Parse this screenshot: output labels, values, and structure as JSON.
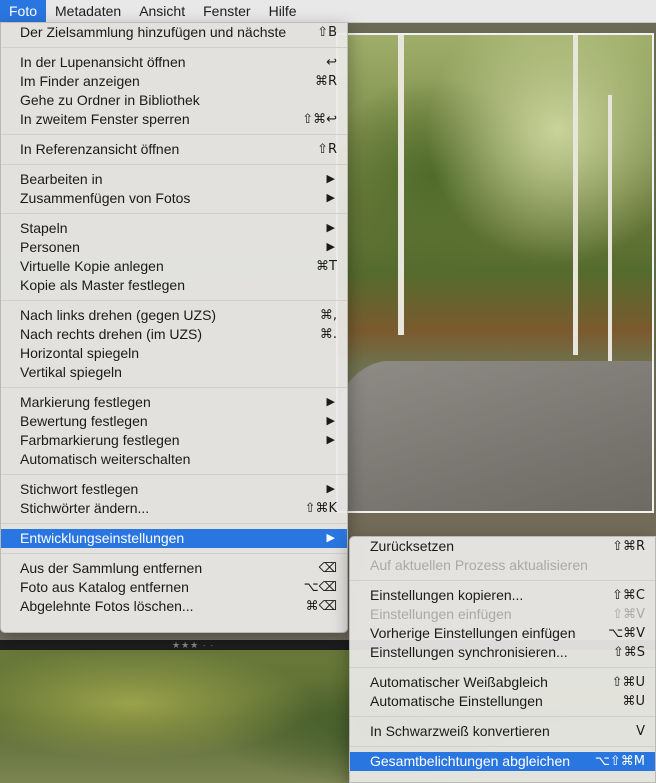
{
  "menubar": [
    {
      "label": "Foto",
      "active": true
    },
    {
      "label": "Metadaten"
    },
    {
      "label": "Ansicht"
    },
    {
      "label": "Fenster"
    },
    {
      "label": "Hilfe"
    }
  ],
  "foto_menu": {
    "groups": [
      [
        {
          "label": "Der Zielsammlung hinzufügen und nächste",
          "shortcut": "⇧B"
        }
      ],
      [
        {
          "label": "In der Lupenansicht öffnen",
          "shortcut": "↩"
        },
        {
          "label": "Im Finder anzeigen",
          "shortcut": "⌘R"
        },
        {
          "label": "Gehe zu Ordner in Bibliothek",
          "shortcut": ""
        },
        {
          "label": "In zweitem Fenster sperren",
          "shortcut": "⇧⌘↩"
        }
      ],
      [
        {
          "label": "In Referenzansicht öffnen",
          "shortcut": "⇧R"
        }
      ],
      [
        {
          "label": "Bearbeiten in",
          "submenu": true
        },
        {
          "label": "Zusammenfügen von Fotos",
          "submenu": true
        }
      ],
      [
        {
          "label": "Stapeln",
          "submenu": true
        },
        {
          "label": "Personen",
          "submenu": true
        },
        {
          "label": "Virtuelle Kopie anlegen",
          "shortcut": "⌘T"
        },
        {
          "label": "Kopie als Master festlegen",
          "shortcut": ""
        }
      ],
      [
        {
          "label": "Nach links drehen (gegen UZS)",
          "shortcut": "⌘,"
        },
        {
          "label": "Nach rechts drehen (im UZS)",
          "shortcut": "⌘."
        },
        {
          "label": "Horizontal spiegeln",
          "shortcut": ""
        },
        {
          "label": "Vertikal spiegeln",
          "shortcut": ""
        }
      ],
      [
        {
          "label": "Markierung festlegen",
          "submenu": true
        },
        {
          "label": "Bewertung festlegen",
          "submenu": true
        },
        {
          "label": "Farbmarkierung festlegen",
          "submenu": true
        },
        {
          "label": "Automatisch weiterschalten",
          "shortcut": ""
        }
      ],
      [
        {
          "label": "Stichwort festlegen",
          "submenu": true
        },
        {
          "label": "Stichwörter ändern...",
          "shortcut": "⇧⌘K"
        }
      ],
      [
        {
          "label": "Entwicklungseinstellungen",
          "submenu": true,
          "highlighted": true
        }
      ],
      [
        {
          "label": "Aus der Sammlung entfernen",
          "shortcut": "⌫"
        },
        {
          "label": "Foto aus Katalog entfernen",
          "shortcut": "⌥⌫"
        },
        {
          "label": "Abgelehnte Fotos löschen...",
          "shortcut": "⌘⌫"
        }
      ]
    ]
  },
  "develop_submenu": {
    "groups": [
      [
        {
          "label": "Zurücksetzen",
          "shortcut": "⇧⌘R"
        },
        {
          "label": "Auf aktuellen Prozess aktualisieren",
          "shortcut": "",
          "disabled": true
        }
      ],
      [
        {
          "label": "Einstellungen kopieren...",
          "shortcut": "⇧⌘C"
        },
        {
          "label": "Einstellungen einfügen",
          "shortcut": "⇧⌘V",
          "disabled": true
        },
        {
          "label": "Vorherige Einstellungen einfügen",
          "shortcut": "⌥⌘V"
        },
        {
          "label": "Einstellungen synchronisieren...",
          "shortcut": "⇧⌘S"
        }
      ],
      [
        {
          "label": "Automatischer Weißabgleich",
          "shortcut": "⇧⌘U"
        },
        {
          "label": "Automatische Einstellungen",
          "shortcut": "⌘U"
        }
      ],
      [
        {
          "label": "In Schwarzweiß konvertieren",
          "shortcut": "V"
        }
      ],
      [
        {
          "label": "Gesamtbelichtungen abgleichen",
          "shortcut": "⌥⇧⌘M",
          "highlighted": true
        }
      ]
    ]
  },
  "filmstrip": {
    "stars": "★★★ · ·"
  },
  "colors": {
    "highlight": "#2a76e0",
    "disabled": "#a9a9a9"
  }
}
